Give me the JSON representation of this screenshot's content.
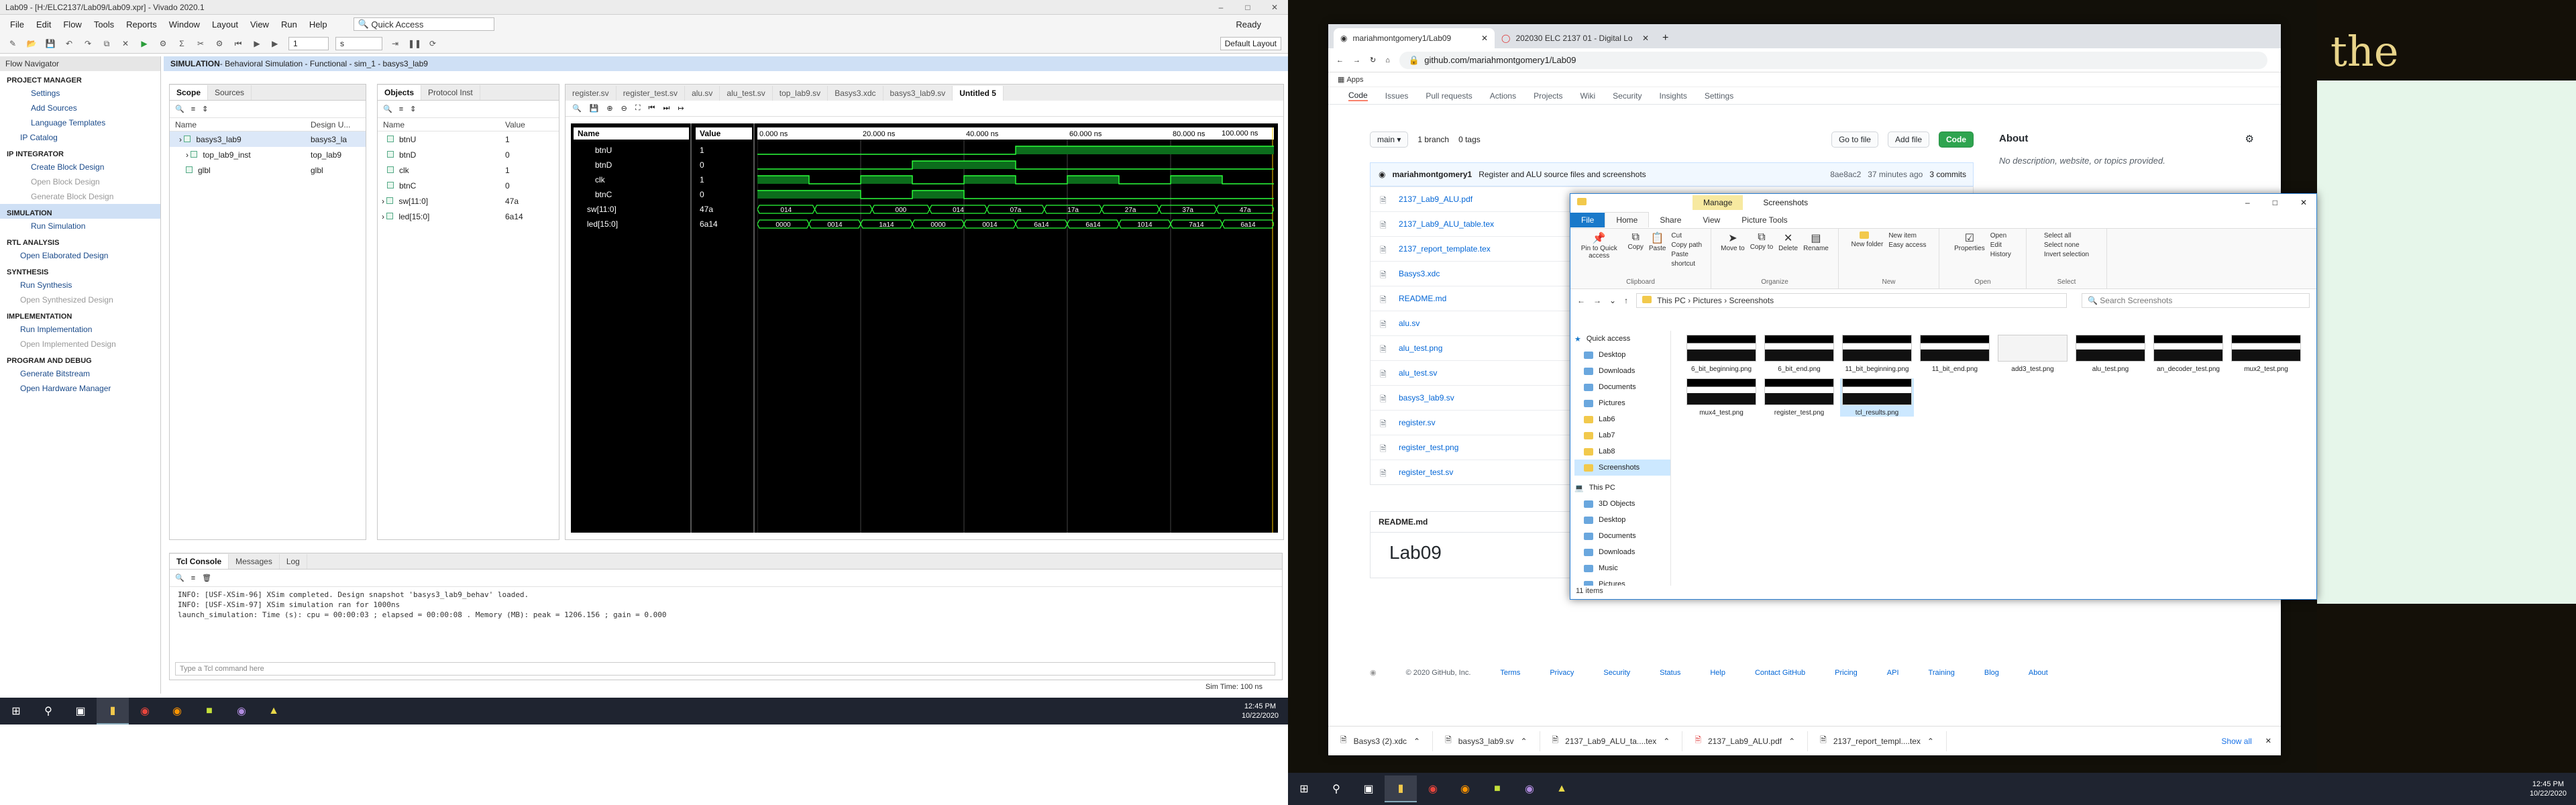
{
  "vivado": {
    "title": "Lab09 - [H:/ELC2137/Lab09/Lab09.xpr] - Vivado 2020.1",
    "menu": [
      "File",
      "Edit",
      "Flow",
      "Tools",
      "Reports",
      "Window",
      "Layout",
      "View",
      "Run",
      "Help"
    ],
    "quick_access": "Quick Access",
    "status_ready": "Ready",
    "run_time_value": "1",
    "run_time_unit": "s",
    "default_layout": "Default Layout",
    "flow_nav": {
      "title": "Flow Navigator",
      "project_manager": "PROJECT MANAGER",
      "pm_items": [
        "Settings",
        "Add Sources",
        "Language Templates",
        "IP Catalog"
      ],
      "ip_integrator": "IP INTEGRATOR",
      "ipi_items": [
        "Create Block Design",
        "Open Block Design",
        "Generate Block Design"
      ],
      "simulation": "SIMULATION",
      "sim_items": [
        "Run Simulation"
      ],
      "rtl": "RTL ANALYSIS",
      "rtl_items": [
        "Open Elaborated Design"
      ],
      "synthesis": "SYNTHESIS",
      "synth_items": [
        "Run Synthesis",
        "Open Synthesized Design"
      ],
      "implementation": "IMPLEMENTATION",
      "impl_items": [
        "Run Implementation",
        "Open Implemented Design"
      ],
      "program": "PROGRAM AND DEBUG",
      "prog_items": [
        "Generate Bitstream",
        "Open Hardware Manager"
      ]
    },
    "sim_header": "SIMULATION",
    "sim_header_detail": " - Behavioral Simulation - Functional - sim_1 - basys3_lab9",
    "scope": {
      "tabs": [
        "Scope",
        "Sources"
      ],
      "col_name": "Name",
      "col_design": "Design U...",
      "rows": [
        {
          "name": "basys3_lab9",
          "design": "basys3_la"
        },
        {
          "name": "top_lab9_inst",
          "design": "top_lab9"
        },
        {
          "name": "glbl",
          "design": "glbl"
        }
      ]
    },
    "objects": {
      "tabs": [
        "Objects",
        "Protocol Inst"
      ],
      "col_name": "Name",
      "col_value": "Value",
      "rows": [
        {
          "name": "btnU",
          "value": "1"
        },
        {
          "name": "btnD",
          "value": "0"
        },
        {
          "name": "clk",
          "value": "1"
        },
        {
          "name": "btnC",
          "value": "0"
        },
        {
          "name": "sw[11:0]",
          "value": "47a"
        },
        {
          "name": "led[15:0]",
          "value": "6a14"
        }
      ]
    },
    "wave_tabs": [
      "register.sv",
      "register_test.sv",
      "alu.sv",
      "alu_test.sv",
      "top_lab9.sv",
      "Basys3.xdc",
      "basys3_lab9.sv",
      "Untitled 5"
    ],
    "wave": {
      "col_name": "Name",
      "col_value": "Value",
      "cursor": "100.000 ns",
      "ticks": [
        "0.000 ns",
        "20.000 ns",
        "40.000 ns",
        "60.000 ns",
        "80.000 ns"
      ],
      "signals": [
        {
          "name": "btnU",
          "value": "1",
          "bits": [
            0,
            0,
            0,
            0,
            0,
            1,
            1,
            1,
            1,
            1
          ]
        },
        {
          "name": "btnD",
          "value": "0",
          "bits": [
            0,
            0,
            0,
            1,
            1,
            0,
            0,
            0,
            0,
            0
          ]
        },
        {
          "name": "clk",
          "value": "1",
          "bits": [
            1,
            0,
            1,
            0,
            1,
            0,
            1,
            0,
            1,
            0
          ]
        },
        {
          "name": "btnC",
          "value": "0",
          "bits": [
            1,
            1,
            0,
            1,
            0,
            0,
            0,
            0,
            0,
            0
          ]
        }
      ],
      "bus_sw": {
        "name": "sw[11:0]",
        "value": "47a",
        "segments": [
          "014",
          "",
          "000",
          "014",
          "07a",
          "17a",
          "27a",
          "37a",
          "47a"
        ]
      },
      "bus_led": {
        "name": "led[15:0]",
        "value": "6a14",
        "segments": [
          "0000",
          "0014",
          "1a14",
          "0000",
          "0014",
          "6a14",
          "6a14",
          "1014",
          "7a14",
          "6a14"
        ]
      }
    },
    "tcl": {
      "tabs": [
        "Tcl Console",
        "Messages",
        "Log"
      ],
      "lines": [
        "INFO: [USF-XSim-96] XSim completed. Design snapshot 'basys3_lab9_behav' loaded.",
        "INFO: [USF-XSim-97] XSim simulation ran for 1000ns",
        "launch_simulation: Time (s): cpu = 00:00:03 ; elapsed = 00:00:08 . Memory (MB): peak = 1206.156 ; gain = 0.000"
      ],
      "placeholder": "Type a Tcl command here"
    },
    "sim_time": "Sim Time: 100 ns"
  },
  "taskbar_left": {
    "time": "12:45 PM",
    "date": "10/22/2020"
  },
  "chrome": {
    "tabs": [
      "mariahmontgomery1/Lab09",
      "202030 ELC 2137 01 - Digital Lo"
    ],
    "url": "github.com/mariahmontgomery1/Lab09",
    "apps": "Apps",
    "repo_nav": [
      "Code",
      "Issues",
      "Pull requests",
      "Actions",
      "Projects",
      "Wiki",
      "Security",
      "Insights",
      "Settings"
    ],
    "branch": "main",
    "branches": "1 branch",
    "tags": "0 tags",
    "goto": "Go to file",
    "addfile": "Add file",
    "code": "Code",
    "commit_author": "mariahmontgomery1",
    "commit_msg": "Register and ALU source files and screenshots",
    "commit_hash": "8ae8ac2",
    "commit_time": "37 minutes ago",
    "commits": "3 commits",
    "files": [
      "2137_Lab9_ALU.pdf",
      "2137_Lab9_ALU_table.tex",
      "2137_report_template.tex",
      "Basys3.xdc",
      "README.md",
      "alu.sv",
      "alu_test.png",
      "alu_test.sv",
      "basys3_lab9.sv",
      "register.sv",
      "register_test.png",
      "register_test.sv"
    ],
    "about": "About",
    "about_desc": "No description, website, or topics provided.",
    "readme_label": "README.md",
    "readme_title": "Lab09",
    "footer": [
      "© 2020 GitHub, Inc.",
      "Terms",
      "Privacy",
      "Security",
      "Status",
      "Help",
      "Contact GitHub",
      "Pricing",
      "API",
      "Training",
      "Blog",
      "About"
    ],
    "downloads": [
      "Basys3 (2).xdc",
      "basys3_lab9.sv",
      "2137_Lab9_ALU_ta....tex",
      "2137_Lab9_ALU.pdf",
      "2137_report_templ....tex"
    ],
    "show_all": "Show all"
  },
  "explorer": {
    "title": "Screenshots",
    "manage": "Manage",
    "tabs": [
      "File",
      "Home",
      "Share",
      "View",
      "Picture Tools"
    ],
    "ribbon_groups": [
      "Clipboard",
      "Organize",
      "New",
      "Open",
      "Select"
    ],
    "ribbon_items": [
      "Pin to Quick access",
      "Copy",
      "Paste",
      "Cut",
      "Copy path",
      "Paste shortcut",
      "Move to",
      "Copy to",
      "Delete",
      "Rename",
      "New folder",
      "New item",
      "Easy access",
      "Properties",
      "Open",
      "Edit",
      "History",
      "Select all",
      "Select none",
      "Invert selection"
    ],
    "path": [
      "This PC",
      "Pictures",
      "Screenshots"
    ],
    "search": "Search Screenshots",
    "tree": [
      "Quick access",
      "Desktop",
      "Downloads",
      "Documents",
      "Pictures",
      "Lab6",
      "Lab7",
      "Lab8",
      "Screenshots",
      "This PC",
      "3D Objects",
      "Desktop",
      "Documents",
      "Downloads",
      "Music",
      "Pictures"
    ],
    "files": [
      "6_bit_beginning.png",
      "6_bit_end.png",
      "11_bit_beginning.png",
      "11_bit_end.png",
      "add3_test.png",
      "alu_test.png",
      "an_decoder_test.png",
      "mux2_test.png",
      "mux4_test.png",
      "register_test.png",
      "tcl_results.png"
    ],
    "items_count": "11 items"
  },
  "bg_text": "the",
  "taskbar_right": {
    "time": "12:45 PM",
    "date": "10/22/2020"
  }
}
